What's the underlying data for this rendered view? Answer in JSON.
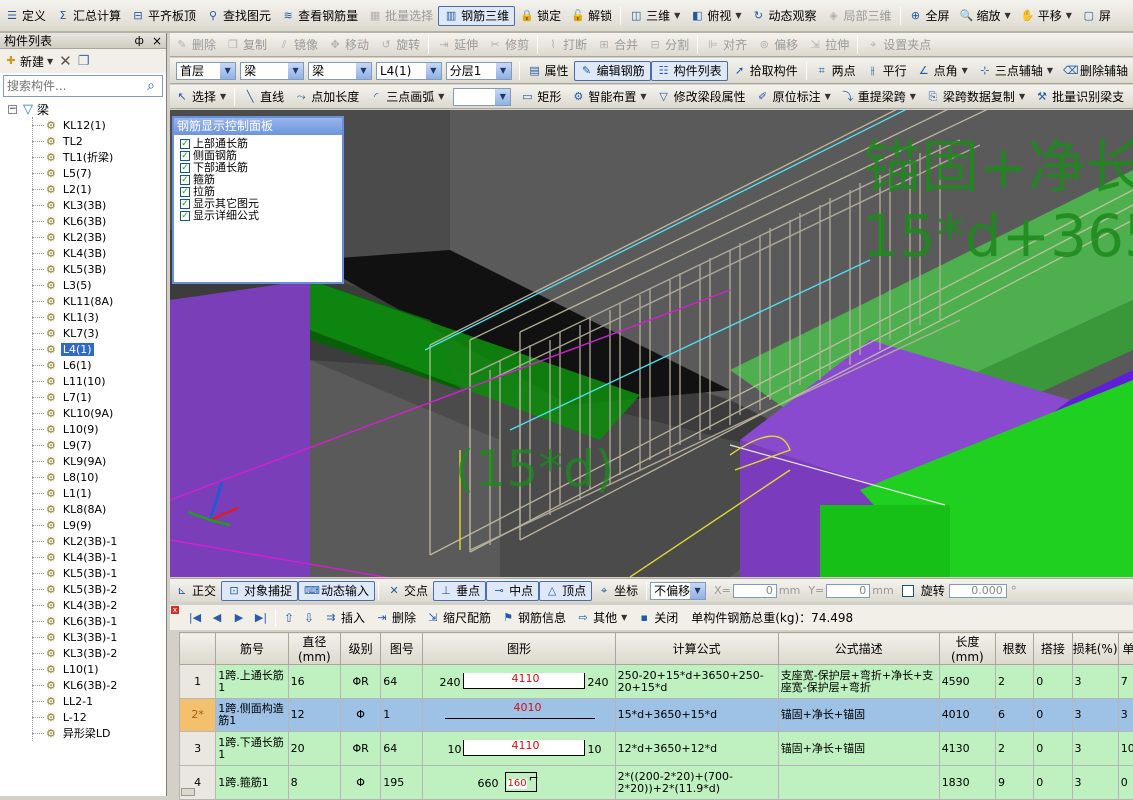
{
  "toolbar1": [
    {
      "icon": "define-icon",
      "label": "定义",
      "state": "normal"
    },
    {
      "icon": "sum-icon",
      "label": "汇总计算",
      "state": "normal"
    },
    {
      "icon": "align-slab-top-icon",
      "label": "平齐板顶",
      "state": "normal"
    },
    {
      "icon": "binoculars-icon",
      "label": "查找图元",
      "state": "normal"
    },
    {
      "icon": "view-rebar-qty-icon",
      "label": "查看钢筋量",
      "state": "normal"
    },
    {
      "icon": "batch-select-icon",
      "label": "批量选择",
      "state": "disabled"
    },
    {
      "icon": "rebar-3d-icon",
      "label": "钢筋三维",
      "state": "active"
    },
    {
      "icon": "lock-icon",
      "label": "锁定",
      "state": "normal"
    },
    {
      "icon": "unlock-icon",
      "label": "解锁",
      "state": "normal"
    },
    {
      "icon": "cube-3d-icon",
      "label": "三维",
      "state": "normal",
      "dropdown": true
    },
    {
      "icon": "top-view-icon",
      "label": "俯视",
      "state": "normal",
      "dropdown": true
    },
    {
      "icon": "dynamic-observe-icon",
      "label": "动态观察",
      "state": "normal"
    },
    {
      "icon": "local-3d-icon",
      "label": "局部三维",
      "state": "disabled"
    },
    {
      "icon": "fullscreen-icon",
      "label": "全屏",
      "state": "normal"
    },
    {
      "icon": "zoom-icon",
      "label": "缩放",
      "state": "normal",
      "dropdown": true
    },
    {
      "icon": "pan-icon",
      "label": "平移",
      "state": "normal",
      "dropdown": true
    },
    {
      "icon": "screen-icon",
      "label": "屏",
      "state": "normal"
    }
  ],
  "toolbar2": [
    {
      "icon": "delete-icon",
      "label": "删除"
    },
    {
      "icon": "copy-icon",
      "label": "复制"
    },
    {
      "icon": "mirror-icon",
      "label": "镜像"
    },
    {
      "icon": "move-icon",
      "label": "移动"
    },
    {
      "icon": "rotate-icon",
      "label": "旋转"
    },
    {
      "icon": "extend-icon",
      "label": "延伸"
    },
    {
      "icon": "trim-icon",
      "label": "修剪"
    },
    {
      "icon": "break-icon",
      "label": "打断"
    },
    {
      "icon": "merge-icon",
      "label": "合并"
    },
    {
      "icon": "split-icon",
      "label": "分割"
    },
    {
      "icon": "align-icon",
      "label": "对齐"
    },
    {
      "icon": "offset-icon",
      "label": "偏移"
    },
    {
      "icon": "stretch-icon",
      "label": "拉伸"
    },
    {
      "icon": "set-grip-icon",
      "label": "设置夹点"
    }
  ],
  "toolbar3": {
    "combos": [
      {
        "value": "首层",
        "w": 64
      },
      {
        "value": "梁",
        "w": 68
      },
      {
        "value": "梁",
        "w": 68
      },
      {
        "value": "L4(1)",
        "w": 70
      },
      {
        "value": "分层1",
        "w": 70
      }
    ],
    "buttons": [
      {
        "icon": "properties-icon",
        "label": "属性"
      },
      {
        "icon": "edit-rebar-icon",
        "label": "编辑钢筋",
        "active": true
      },
      {
        "icon": "component-list-icon",
        "label": "构件列表",
        "active": true
      },
      {
        "icon": "pick-component-icon",
        "label": "拾取构件"
      },
      {
        "icon": "two-points-icon",
        "label": "两点"
      },
      {
        "icon": "parallel-icon",
        "label": "平行"
      },
      {
        "icon": "point-angle-icon",
        "label": "点角",
        "dropdown": true
      },
      {
        "icon": "three-point-axis-icon",
        "label": "三点辅轴",
        "dropdown": true
      },
      {
        "icon": "delete-aux-icon",
        "label": "删除辅轴"
      }
    ]
  },
  "toolbar4": [
    {
      "icon": "cursor-icon",
      "label": "选择",
      "dropdown": true
    },
    {
      "icon": "line-icon",
      "label": "直线"
    },
    {
      "icon": "point-extend-icon",
      "label": "点加长度"
    },
    {
      "icon": "arc-icon",
      "label": "三点画弧",
      "dropdown": true
    },
    {
      "icon": "rect-icon",
      "label": "矩形"
    },
    {
      "icon": "smart-layout-icon",
      "label": "智能布置",
      "dropdown": true
    },
    {
      "icon": "modify-span-icon",
      "label": "修改梁段属性"
    },
    {
      "icon": "in-situ-label-icon",
      "label": "原位标注",
      "dropdown": true
    },
    {
      "icon": "re-extract-span-icon",
      "label": "重提梁跨",
      "dropdown": true
    },
    {
      "icon": "span-copy-icon",
      "label": "梁跨数据复制",
      "dropdown": true
    },
    {
      "icon": "batch-identify-icon",
      "label": "批量识别梁支"
    }
  ],
  "left_panel": {
    "title": "构件列表",
    "pin": "ф",
    "close": "×",
    "new_label": "新建",
    "search_placeholder": "搜索构件...",
    "root": "梁",
    "items": [
      "KL12(1)",
      "TL2",
      "TL1(折梁)",
      "L5(7)",
      "L2(1)",
      "KL3(3B)",
      "KL6(3B)",
      "KL2(3B)",
      "KL4(3B)",
      "KL5(3B)",
      "L3(5)",
      "KL11(8A)",
      "KL1(3)",
      "KL7(3)",
      "L4(1)",
      "L6(1)",
      "L11(10)",
      "L7(1)",
      "KL10(9A)",
      "L10(9)",
      "L9(7)",
      "KL9(9A)",
      "L8(10)",
      "L1(1)",
      "KL8(8A)",
      "L9(9)",
      "KL2(3B)-1",
      "KL4(3B)-1",
      "KL5(3B)-1",
      "KL5(3B)-2",
      "KL4(3B)-2",
      "KL6(3B)-1",
      "KL3(3B)-1",
      "KL3(3B)-2",
      "L10(1)",
      "KL6(3B)-2",
      "LL2-1",
      "L-12",
      "异形梁LD"
    ],
    "selected": "L4(1)"
  },
  "panel": {
    "title": "钢筋显示控制面板",
    "options": [
      "上部通长筋",
      "侧面钢筋",
      "下部通长筋",
      "箍筋",
      "拉筋",
      "显示其它图元",
      "显示详细公式"
    ]
  },
  "viewport": {
    "label1": "锚固+净长",
    "label2": "15*d+365",
    "label3": "(15*d)",
    "colors": {
      "green_text": "#1c8a1c",
      "purple": "#8a4ad0",
      "bright_green": "#20d020"
    }
  },
  "bottombar": {
    "items": [
      {
        "icon": "ortho-icon",
        "label": "正交"
      },
      {
        "icon": "object-snap-icon",
        "label": "对象捕捉",
        "active": true
      },
      {
        "icon": "dynamic-input-icon",
        "label": "动态输入",
        "active": true
      },
      {
        "icon": "intersection-icon",
        "label": "交点"
      },
      {
        "icon": "perpendicular-icon",
        "label": "垂点",
        "active": true
      },
      {
        "icon": "midpoint-icon",
        "label": "中点",
        "active": true
      },
      {
        "icon": "vertex-icon",
        "label": "顶点",
        "active": true
      },
      {
        "icon": "coordinate-icon",
        "label": "坐标"
      }
    ],
    "offset_value": "不偏移",
    "x_label": "X=",
    "x_value": "0",
    "y_label": "Y=",
    "y_value": "0",
    "unit": "mm",
    "rotate_label": "旋转",
    "rotate_value": "0.000",
    "degree": "°"
  },
  "grid_toolbar": {
    "items": [
      {
        "icon": "insert-icon",
        "label": "插入"
      },
      {
        "icon": "delete-row-icon",
        "label": "删除"
      },
      {
        "icon": "scale-rebar-icon",
        "label": "缩尺配筋"
      },
      {
        "icon": "rebar-info-icon",
        "label": "钢筋信息"
      },
      {
        "icon": "other-icon",
        "label": "其他",
        "dropdown": true
      },
      {
        "icon": "close-icon",
        "label": "关闭"
      }
    ],
    "total": "单构件钢筋总重(kg)：74.498"
  },
  "table": {
    "headers": [
      "",
      "筋号",
      "直径(mm)",
      "级别",
      "图号",
      "图形",
      "计算公式",
      "公式描述",
      "长度(mm)",
      "根数",
      "搭接",
      "损耗(%)",
      "单"
    ],
    "rows": [
      {
        "num": "1",
        "name": "1跨.上通长筋1",
        "dia": "16",
        "grade": "ΦR",
        "fig": "64",
        "shape": {
          "left": "240",
          "mid": "4110",
          "right": "240"
        },
        "formula": "250-20+15*d+3650+250-20+15*d",
        "desc": "支座宽-保护层+弯折+净长+支座宽-保护层+弯折",
        "length": "4590",
        "count": "2",
        "lap": "0",
        "loss": "3",
        "unit": "7"
      },
      {
        "num": "2*",
        "name": "1跨.侧面构造筋1",
        "dia": "12",
        "grade": "Φ",
        "fig": "1",
        "shape": {
          "left": "",
          "mid": "4010",
          "right": ""
        },
        "formula": "15*d+3650+15*d",
        "desc": "锚固+净长+锚固",
        "length": "4010",
        "count": "6",
        "lap": "0",
        "loss": "3",
        "unit": "3"
      },
      {
        "num": "3",
        "name": "1跨.下通长筋1",
        "dia": "20",
        "grade": "ΦR",
        "fig": "64",
        "shape": {
          "left": "10",
          "mid": "4110",
          "right": "10"
        },
        "formula": "12*d+3650+12*d",
        "desc": "锚固+净长+锚固",
        "length": "4130",
        "count": "2",
        "lap": "0",
        "loss": "3",
        "unit": "10"
      },
      {
        "num": "4",
        "name": "1跨.箍筋1",
        "dia": "8",
        "grade": "Φ",
        "fig": "195",
        "shape": {
          "left": "660",
          "mid": "160",
          "right": ""
        },
        "formula": "2*((200-2*20)+(700-2*20))+2*(11.9*d)",
        "desc": "",
        "length": "1830",
        "count": "9",
        "lap": "0",
        "loss": "3",
        "unit": "0"
      }
    ],
    "selected_row": 1
  }
}
